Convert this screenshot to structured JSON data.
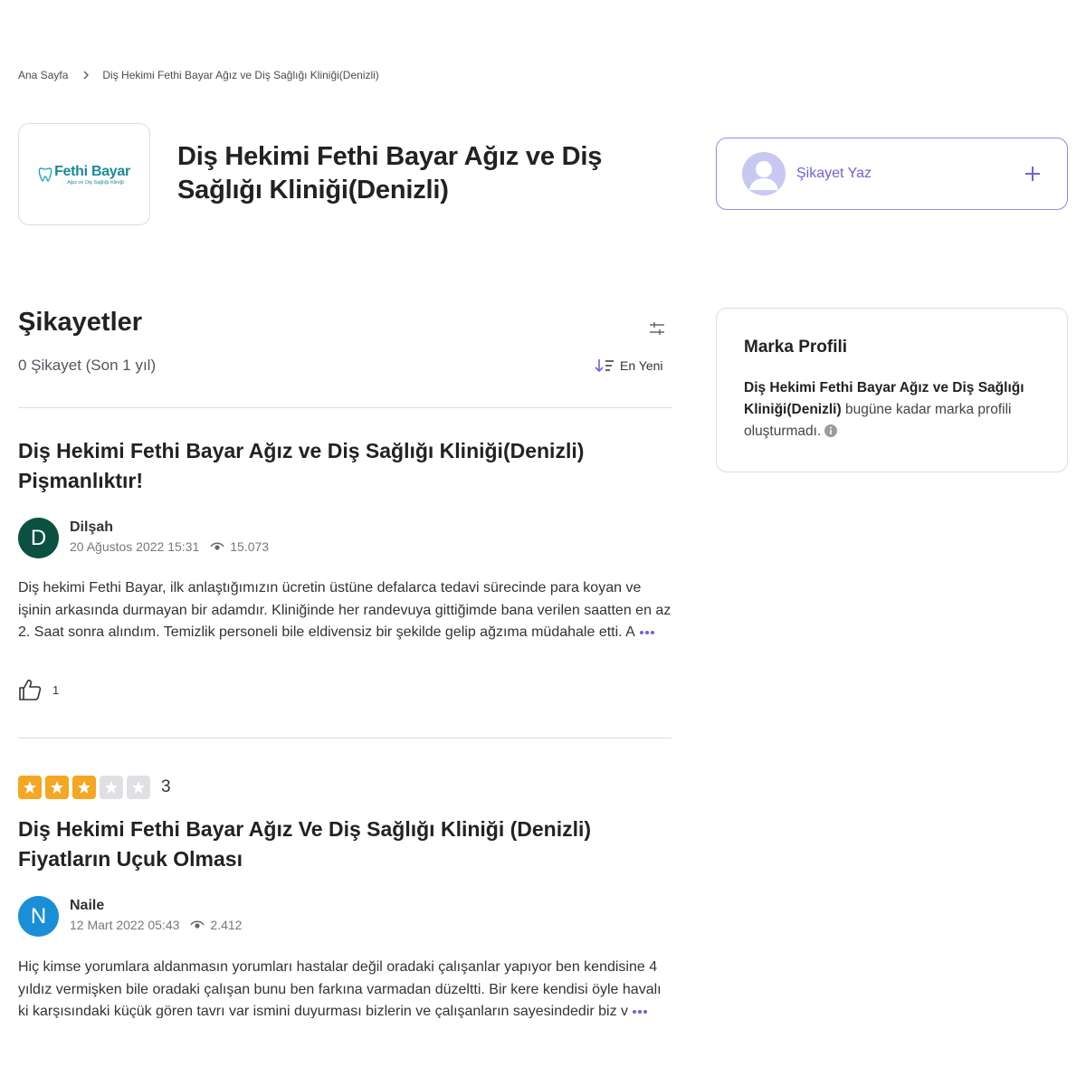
{
  "breadcrumb": {
    "home": "Ana Sayfa",
    "current": "Diş Hekimi Fethi Bayar Ağız ve Diş Sağlığı Kliniği(Denizli)"
  },
  "brand": {
    "logo_name": "Fethi Bayar",
    "logo_sub": "Ağız ve Diş Sağlığı Kliniği",
    "title": "Diş Hekimi Fethi Bayar Ağız ve Diş Sağlığı Kliniği(Denizli)"
  },
  "write": {
    "label": "Şikayet Yaz"
  },
  "complaints": {
    "title": "Şikayetler",
    "count": "0 Şikayet (Son 1 yıl)",
    "sort_label": "En Yeni"
  },
  "profile": {
    "title": "Marka Profili",
    "brand_name": "Diş Hekimi Fethi Bayar Ağız ve Diş Sağlığı Kliniği(Denizli)",
    "text": "bugüne kadar marka profili oluşturmadı."
  },
  "cards": [
    {
      "title": "Diş Hekimi Fethi Bayar Ağız ve Diş Sağlığı Kliniği(Denizli) Pişmanlıktır!",
      "initial": "D",
      "avatar_color": "#0b5040",
      "author": "Dilşah",
      "date": "20 Ağustos 2022 15:31",
      "views": "15.073",
      "body": "Diş hekimi Fethi Bayar, ilk anlaştığımızın ücretin üstüne defalarca tedavi sürecinde para koyan ve işinin arkasında durmayan bir adamdır. Kliniğinde her randevuya gittiğimde bana verilen saatten en az 2. Saat sonra alındım. Temizlik personeli bile eldivensiz bir şekilde gelip ağzıma müdahale etti. A",
      "likes": "1"
    },
    {
      "rating": 3,
      "rating_label": "3",
      "title": "Diş Hekimi Fethi Bayar Ağız Ve Diş Sağlığı Kliniği (Denizli) Fiyatların Uçuk Olması",
      "initial": "N",
      "avatar_color": "#1a8fd6",
      "author": "Naile",
      "date": "12 Mart 2022 05:43",
      "views": "2.412",
      "body": "Hiç kimse yorumlara aldanmasın yorumları hastalar değil oradaki çalışanlar yapıyor ben kendisine 4 yıldız vermişken bile oradaki çalışan bunu ben farkına varmadan düzeltti. Bir kere kendisi öyle havalı ki karşısındaki küçük gören tavrı var ismini duyurması bizlerin ve çalışanların sayesindedir biz v"
    }
  ],
  "colors": {
    "accent": "#6c63d9",
    "star_on": "#f5a623",
    "star_off": "#e0e0e4"
  }
}
